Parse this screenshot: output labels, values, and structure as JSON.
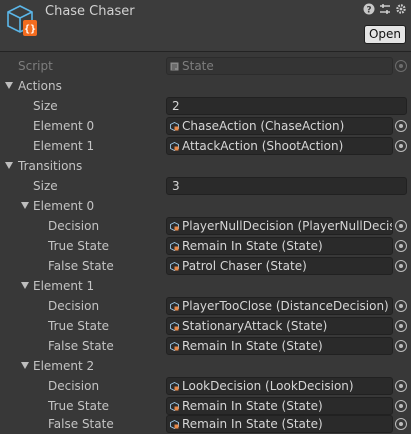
{
  "header": {
    "title": "Chase Chaser",
    "open_label": "Open",
    "icons": [
      "help-icon",
      "preset-icon",
      "settings-icon"
    ]
  },
  "script": {
    "label": "Script",
    "value": "State"
  },
  "actions": {
    "label": "Actions",
    "size_label": "Size",
    "size": "2",
    "elements": [
      {
        "label": "Element 0",
        "value": "ChaseAction (ChaseAction)"
      },
      {
        "label": "Element 1",
        "value": "AttackAction (ShootAction)"
      }
    ]
  },
  "transitions": {
    "label": "Transitions",
    "size_label": "Size",
    "size": "3",
    "elements": [
      {
        "label": "Element 0",
        "decision_label": "Decision",
        "decision": "PlayerNullDecision (PlayerNullDecisi",
        "true_label": "True State",
        "true_state": "Remain In State (State)",
        "false_label": "False State",
        "false_state": "Patrol Chaser (State)"
      },
      {
        "label": "Element 1",
        "decision_label": "Decision",
        "decision": "PlayerTooClose (DistanceDecision)",
        "true_label": "True State",
        "true_state": "StationaryAttack (State)",
        "false_label": "False State",
        "false_state": "Remain In State (State)"
      },
      {
        "label": "Element 2",
        "decision_label": "Decision",
        "decision": "LookDecision (LookDecision)",
        "true_label": "True State",
        "true_state": "Remain In State (State)",
        "false_label": "False State",
        "false_state": "Remain In State (State)"
      }
    ]
  }
}
